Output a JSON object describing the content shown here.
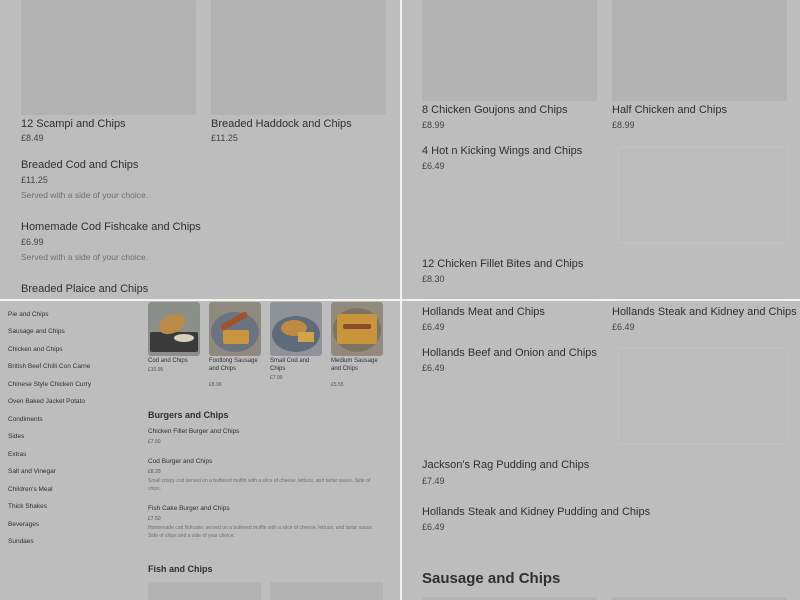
{
  "q1": {
    "items": [
      {
        "name": "12 Scampi and Chips",
        "price": "£8.49"
      },
      {
        "name": "Breaded Haddock and Chips",
        "price": "£11.25"
      },
      {
        "name": "Breaded Cod and Chips",
        "price": "£11.25",
        "desc": "Served with a side of your choice."
      },
      {
        "name": "Homemade Cod Fishcake and Chips",
        "price": "£6.99",
        "desc": "Served with a side of your choice."
      },
      {
        "name": "Breaded Plaice and Chips"
      }
    ]
  },
  "q2": {
    "items": [
      {
        "name": "8 Chicken Goujons and Chips",
        "price": "£8.99"
      },
      {
        "name": "Half Chicken and Chips",
        "price": "£8.99"
      },
      {
        "name": "4 Hot n Kicking Wings and Chips",
        "price": "£6.49"
      },
      {
        "name": "12 Chicken Fillet Bites and Chips",
        "price": "£8.30"
      }
    ]
  },
  "q3": {
    "sidebar": [
      "Pie and Chips",
      "Sausage and Chips",
      "Chicken and Chips",
      "British Beef Chilli Con Carne",
      "Chinese Style Chicken Curry",
      "Oven Baked Jacket Potato",
      "Condiments",
      "Sides",
      "Extras",
      "Salt and Vinegar",
      "Children's Meal",
      "Thick Shakes",
      "Beverages",
      "Sundaes"
    ],
    "featured": [
      {
        "name": "Cod and Chips",
        "price": "£10.95"
      },
      {
        "name": "Footlong Sausage and Chips",
        "price": "£8.99"
      },
      {
        "name": "Small Cod and Chips",
        "price": "£7.99"
      },
      {
        "name": "Medium Sausage and Chips",
        "price": "£5.55"
      }
    ],
    "burgers_title": "Burgers and Chips",
    "burgers": [
      {
        "name": "Chicken Fillet Burger and Chips",
        "price": "£7.50"
      },
      {
        "name": "Cod Burger and Chips",
        "price": "£8.20",
        "desc": "Small crispy cod served on a buttered muffin with a slice of cheese, lettuce, and tartar sauce. Side of chips."
      },
      {
        "name": "Fish Cake Burger and Chips",
        "price": "£7.50",
        "desc": "Homemade cod fishcake, served on a buttered muffin with a slice of cheese, lettuce, and tartar sauce. Side of chips and a side of your choice."
      }
    ],
    "fish_title": "Fish and Chips"
  },
  "q4": {
    "items": [
      {
        "name": "Hollands Meat and Chips",
        "price": "£6.49"
      },
      {
        "name": "Hollands Steak and Kidney and Chips",
        "price": "£6.49"
      },
      {
        "name": "Hollands Beef and Onion and Chips",
        "price": "£6.49"
      },
      {
        "name": "Jackson's Rag Pudding and Chips",
        "price": "£7.49"
      },
      {
        "name": "Hollands Steak and Kidney Pudding and Chips",
        "price": "£6.49"
      }
    ],
    "section_title": "Sausage and Chips"
  }
}
